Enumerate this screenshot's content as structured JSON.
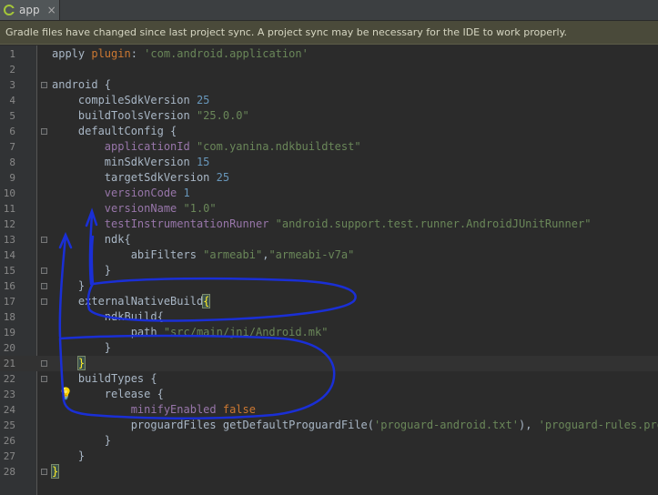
{
  "tab": {
    "icon": "gradle-icon",
    "label": "app",
    "close": "×"
  },
  "banner": {
    "text": "Gradle files have changed since last project sync. A project sync may be necessary for the IDE to work properly."
  },
  "lines": [
    {
      "n": "1",
      "parts": [
        [
          "plain",
          "apply "
        ],
        [
          "kw",
          "plugin"
        ],
        [
          "plain",
          ": "
        ],
        [
          "str",
          "'com.android.application'"
        ]
      ]
    },
    {
      "n": "2",
      "parts": []
    },
    {
      "n": "3",
      "parts": [
        [
          "plain",
          "android {"
        ]
      ]
    },
    {
      "n": "4",
      "parts": [
        [
          "plain",
          "    compileSdkVersion "
        ],
        [
          "num",
          "25"
        ]
      ]
    },
    {
      "n": "5",
      "parts": [
        [
          "plain",
          "    buildToolsVersion "
        ],
        [
          "str",
          "\"25.0.0\""
        ]
      ]
    },
    {
      "n": "6",
      "parts": [
        [
          "plain",
          "    defaultConfig {"
        ]
      ]
    },
    {
      "n": "7",
      "parts": [
        [
          "plain",
          "        "
        ],
        [
          "prop",
          "applicationId "
        ],
        [
          "str",
          "\"com.yanina.ndkbuildtest\""
        ]
      ]
    },
    {
      "n": "8",
      "parts": [
        [
          "plain",
          "        minSdkVersion "
        ],
        [
          "num",
          "15"
        ]
      ]
    },
    {
      "n": "9",
      "parts": [
        [
          "plain",
          "        targetSdkVersion "
        ],
        [
          "num",
          "25"
        ]
      ]
    },
    {
      "n": "10",
      "parts": [
        [
          "plain",
          "        "
        ],
        [
          "prop",
          "versionCode "
        ],
        [
          "num",
          "1"
        ]
      ]
    },
    {
      "n": "11",
      "parts": [
        [
          "plain",
          "        "
        ],
        [
          "prop",
          "versionName "
        ],
        [
          "str",
          "\"1.0\""
        ]
      ]
    },
    {
      "n": "12",
      "parts": [
        [
          "plain",
          "        "
        ],
        [
          "prop",
          "testInstrumentationRunner "
        ],
        [
          "str",
          "\"android.support.test.runner.AndroidJUnitRunner\""
        ]
      ]
    },
    {
      "n": "13",
      "parts": [
        [
          "plain",
          "        ndk{"
        ]
      ]
    },
    {
      "n": "14",
      "parts": [
        [
          "plain",
          "            abiFilters "
        ],
        [
          "str",
          "\"armeabi\""
        ],
        [
          "plain",
          ","
        ],
        [
          "str",
          "\"armeabi-v7a\""
        ]
      ]
    },
    {
      "n": "15",
      "parts": [
        [
          "plain",
          "        }"
        ]
      ]
    },
    {
      "n": "16",
      "parts": [
        [
          "plain",
          "    }"
        ]
      ]
    },
    {
      "n": "17",
      "parts": [
        [
          "plain",
          "    externalNativeBuild"
        ],
        [
          "hl",
          "{"
        ]
      ]
    },
    {
      "n": "18",
      "parts": [
        [
          "plain",
          "        ndkBuild{"
        ]
      ]
    },
    {
      "n": "19",
      "parts": [
        [
          "plain",
          "            path "
        ],
        [
          "str",
          "\"src/main/jni/Android.mk\""
        ]
      ]
    },
    {
      "n": "20",
      "parts": [
        [
          "plain",
          "        }"
        ]
      ]
    },
    {
      "n": "21",
      "parts": [
        [
          "plain",
          "    "
        ],
        [
          "hl",
          "}"
        ]
      ]
    },
    {
      "n": "22",
      "parts": [
        [
          "plain",
          "    buildTypes {"
        ]
      ]
    },
    {
      "n": "23",
      "parts": [
        [
          "plain",
          "        release {"
        ]
      ]
    },
    {
      "n": "24",
      "parts": [
        [
          "plain",
          "            "
        ],
        [
          "prop",
          "minifyEnabled "
        ],
        [
          "kw",
          "false"
        ]
      ]
    },
    {
      "n": "25",
      "parts": [
        [
          "plain",
          "            proguardFiles getDefaultProguardFile("
        ],
        [
          "str",
          "'proguard-android.txt'"
        ],
        [
          "plain",
          "), "
        ],
        [
          "str",
          "'proguard-rules.pro'"
        ]
      ]
    },
    {
      "n": "26",
      "parts": [
        [
          "plain",
          "        }"
        ]
      ]
    },
    {
      "n": "27",
      "parts": [
        [
          "plain",
          "    }"
        ]
      ]
    },
    {
      "n": "28",
      "parts": [
        [
          "hl",
          "}"
        ]
      ]
    }
  ],
  "colors": {
    "background": "#2b2b2b",
    "keyword": "#cc7832",
    "string": "#6a8759",
    "number": "#6897bb",
    "property": "#9876aa",
    "ink": "#1a2fd6"
  }
}
